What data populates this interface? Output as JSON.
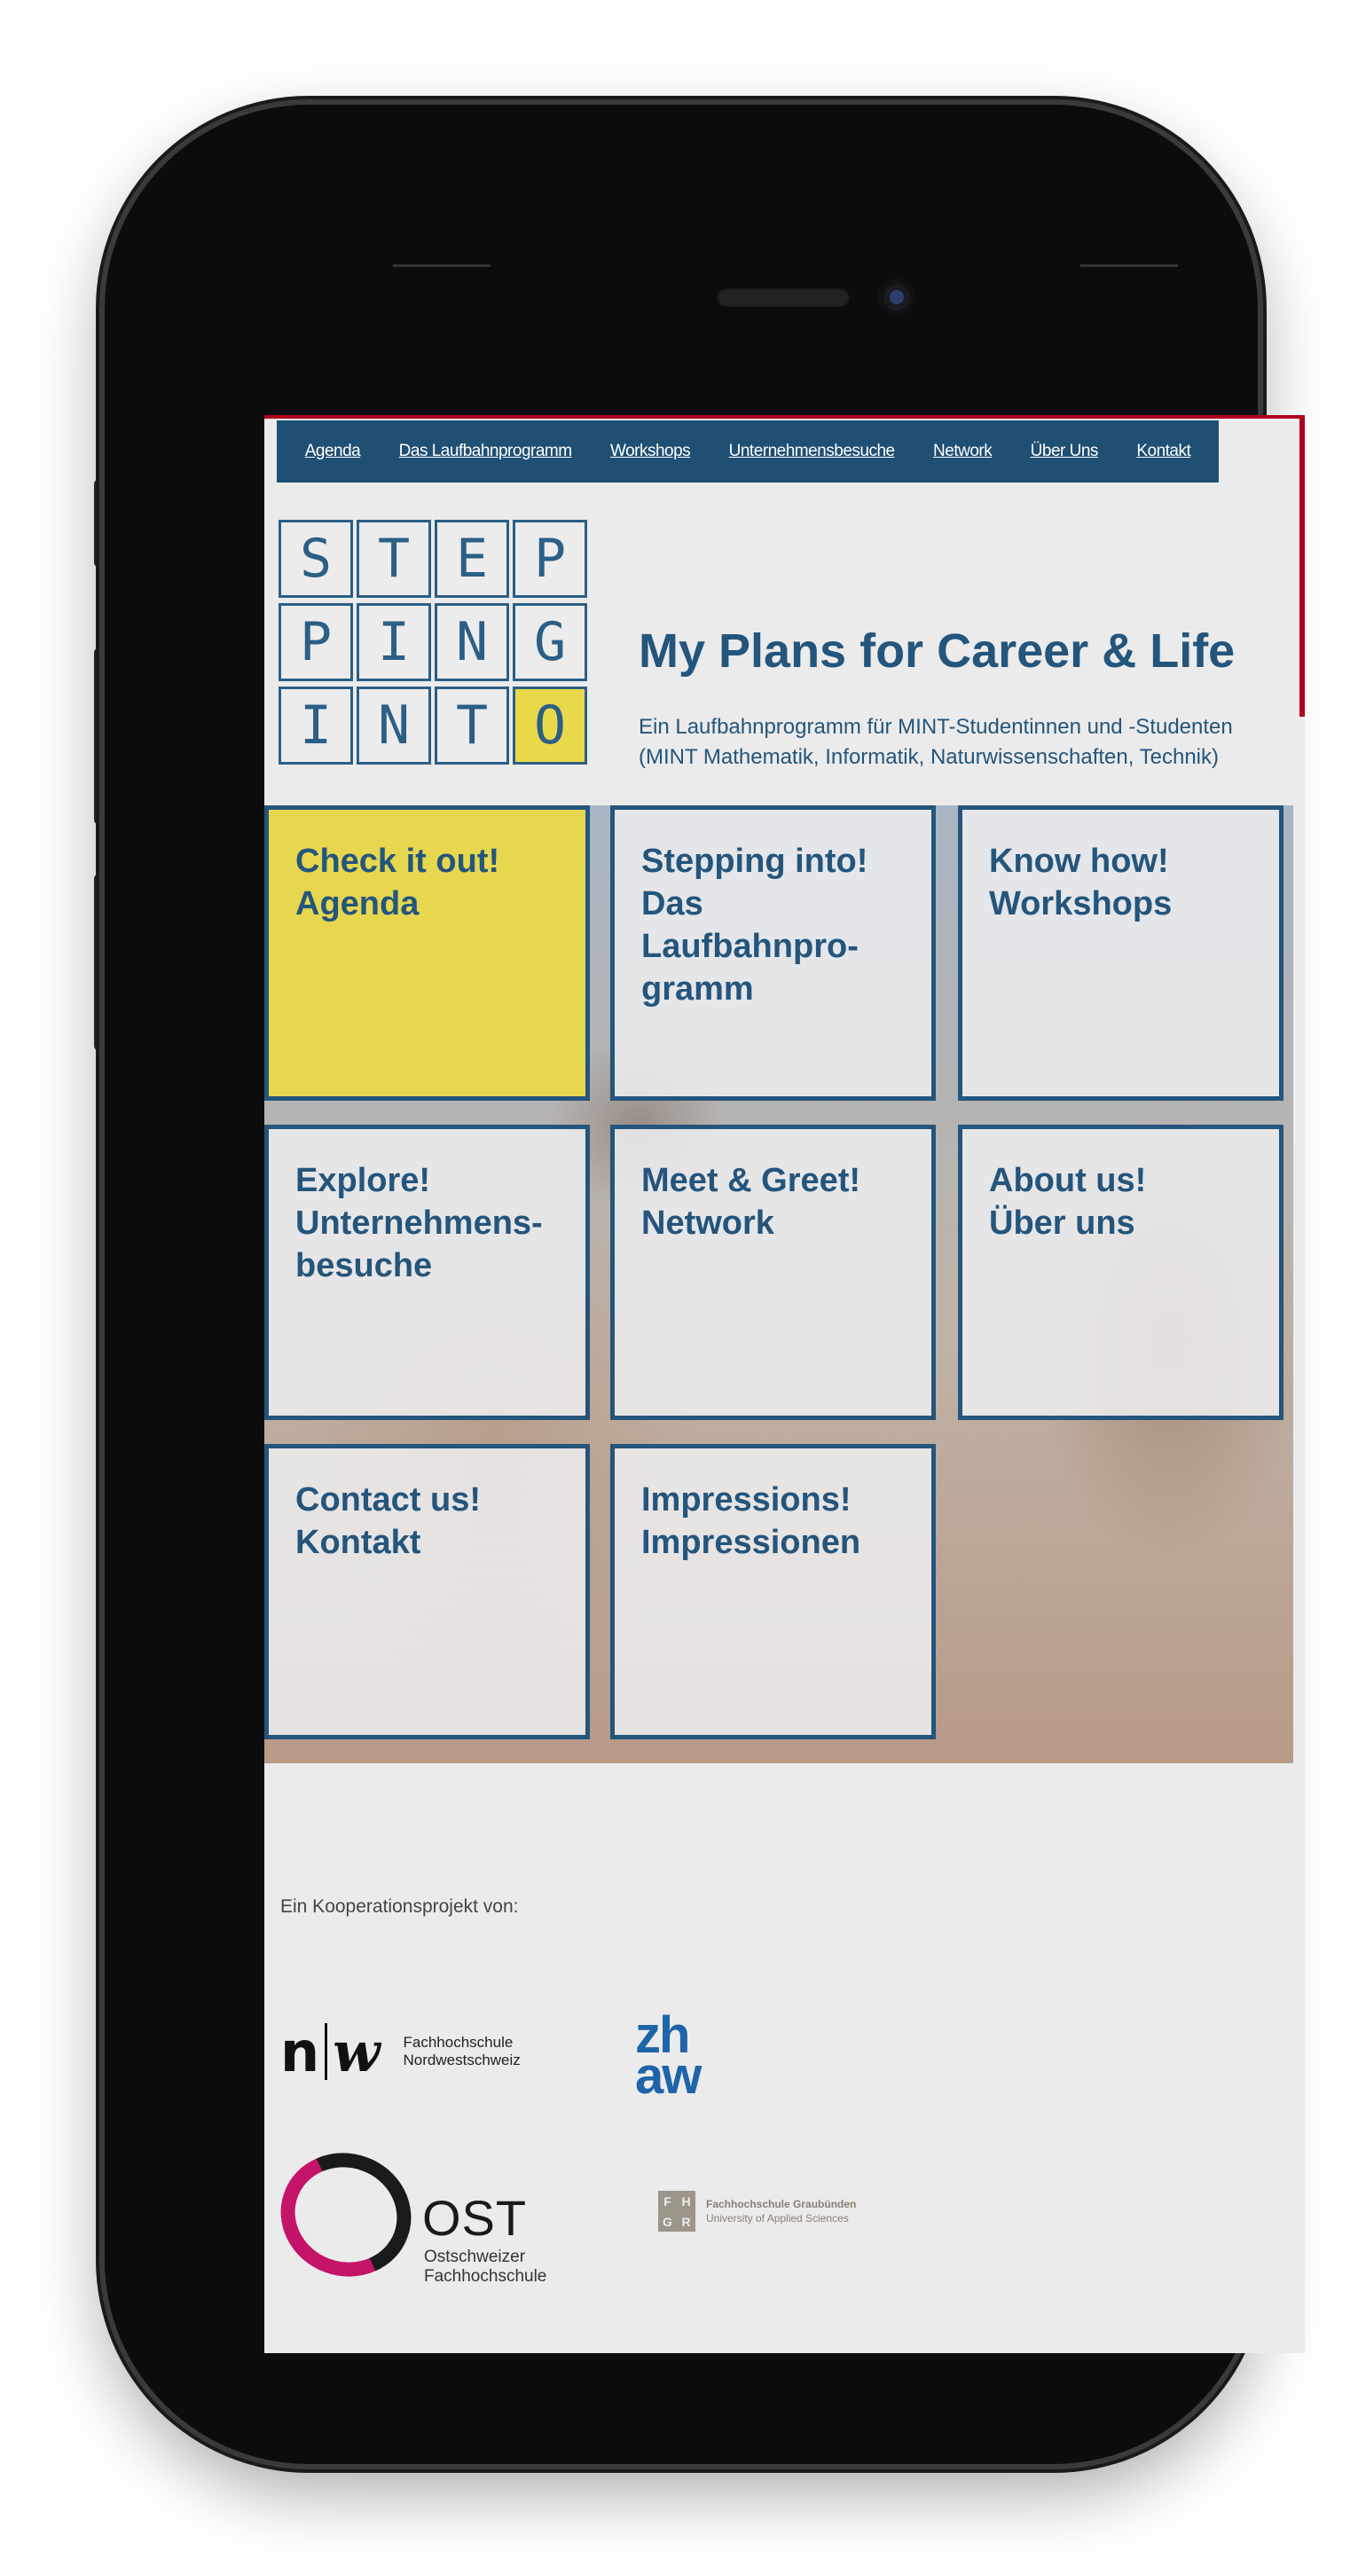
{
  "nav": {
    "items": [
      "Agenda",
      "Das Laufbahnprogramm",
      "Workshops",
      "Unternehmensbesuche",
      "Network",
      "Über Uns",
      "Kontakt"
    ]
  },
  "logo": {
    "letters": [
      "S",
      "T",
      "E",
      "P",
      "P",
      "I",
      "N",
      "G",
      "I",
      "N",
      "T",
      "O"
    ]
  },
  "header": {
    "title": "My Plans for Career & Life",
    "subtitle_line1": "Ein Laufbahnprogramm für MINT-Studentinnen und -Studenten",
    "subtitle_line2": "(MINT Mathematik, Informatik, Naturwissenschaften, Technik)"
  },
  "tiles": [
    {
      "label": "Check it out!\nAgenda"
    },
    {
      "label": "Stepping into!\nDas\nLaufbahnpro-\ngramm"
    },
    {
      "label": "Know how!\nWorkshops"
    },
    {
      "label": "Explore!\nUnternehmens-\nbesuche"
    },
    {
      "label": "Meet & Greet!\nNetwork"
    },
    {
      "label": "About us!\nÜber uns"
    },
    {
      "label": "Contact us!\nKontakt"
    },
    {
      "label": "Impressions!\nImpressionen"
    }
  ],
  "footer": {
    "coop_text": "Ein Kooperationsprojekt von:",
    "fhnw": {
      "n": "n",
      "w": "w",
      "line1": "Fachhochschule",
      "line2": "Nordwestschweiz"
    },
    "zhaw": {
      "line1": "zh",
      "line2": "aw"
    },
    "ost": {
      "name": "OST",
      "line1": "Ostschweizer",
      "line2": "Fachhochschule"
    },
    "fhgr": {
      "box": [
        "F",
        "H",
        "G",
        "R"
      ],
      "line1": "Fachhochschule Graubünden",
      "line2": "University of Applied Sciences"
    }
  },
  "colors": {
    "nav_bg": "#1f4f73",
    "accent_blue": "#24557c",
    "tile_yellow": "#e8d84a",
    "accent_red": "#b00020"
  }
}
